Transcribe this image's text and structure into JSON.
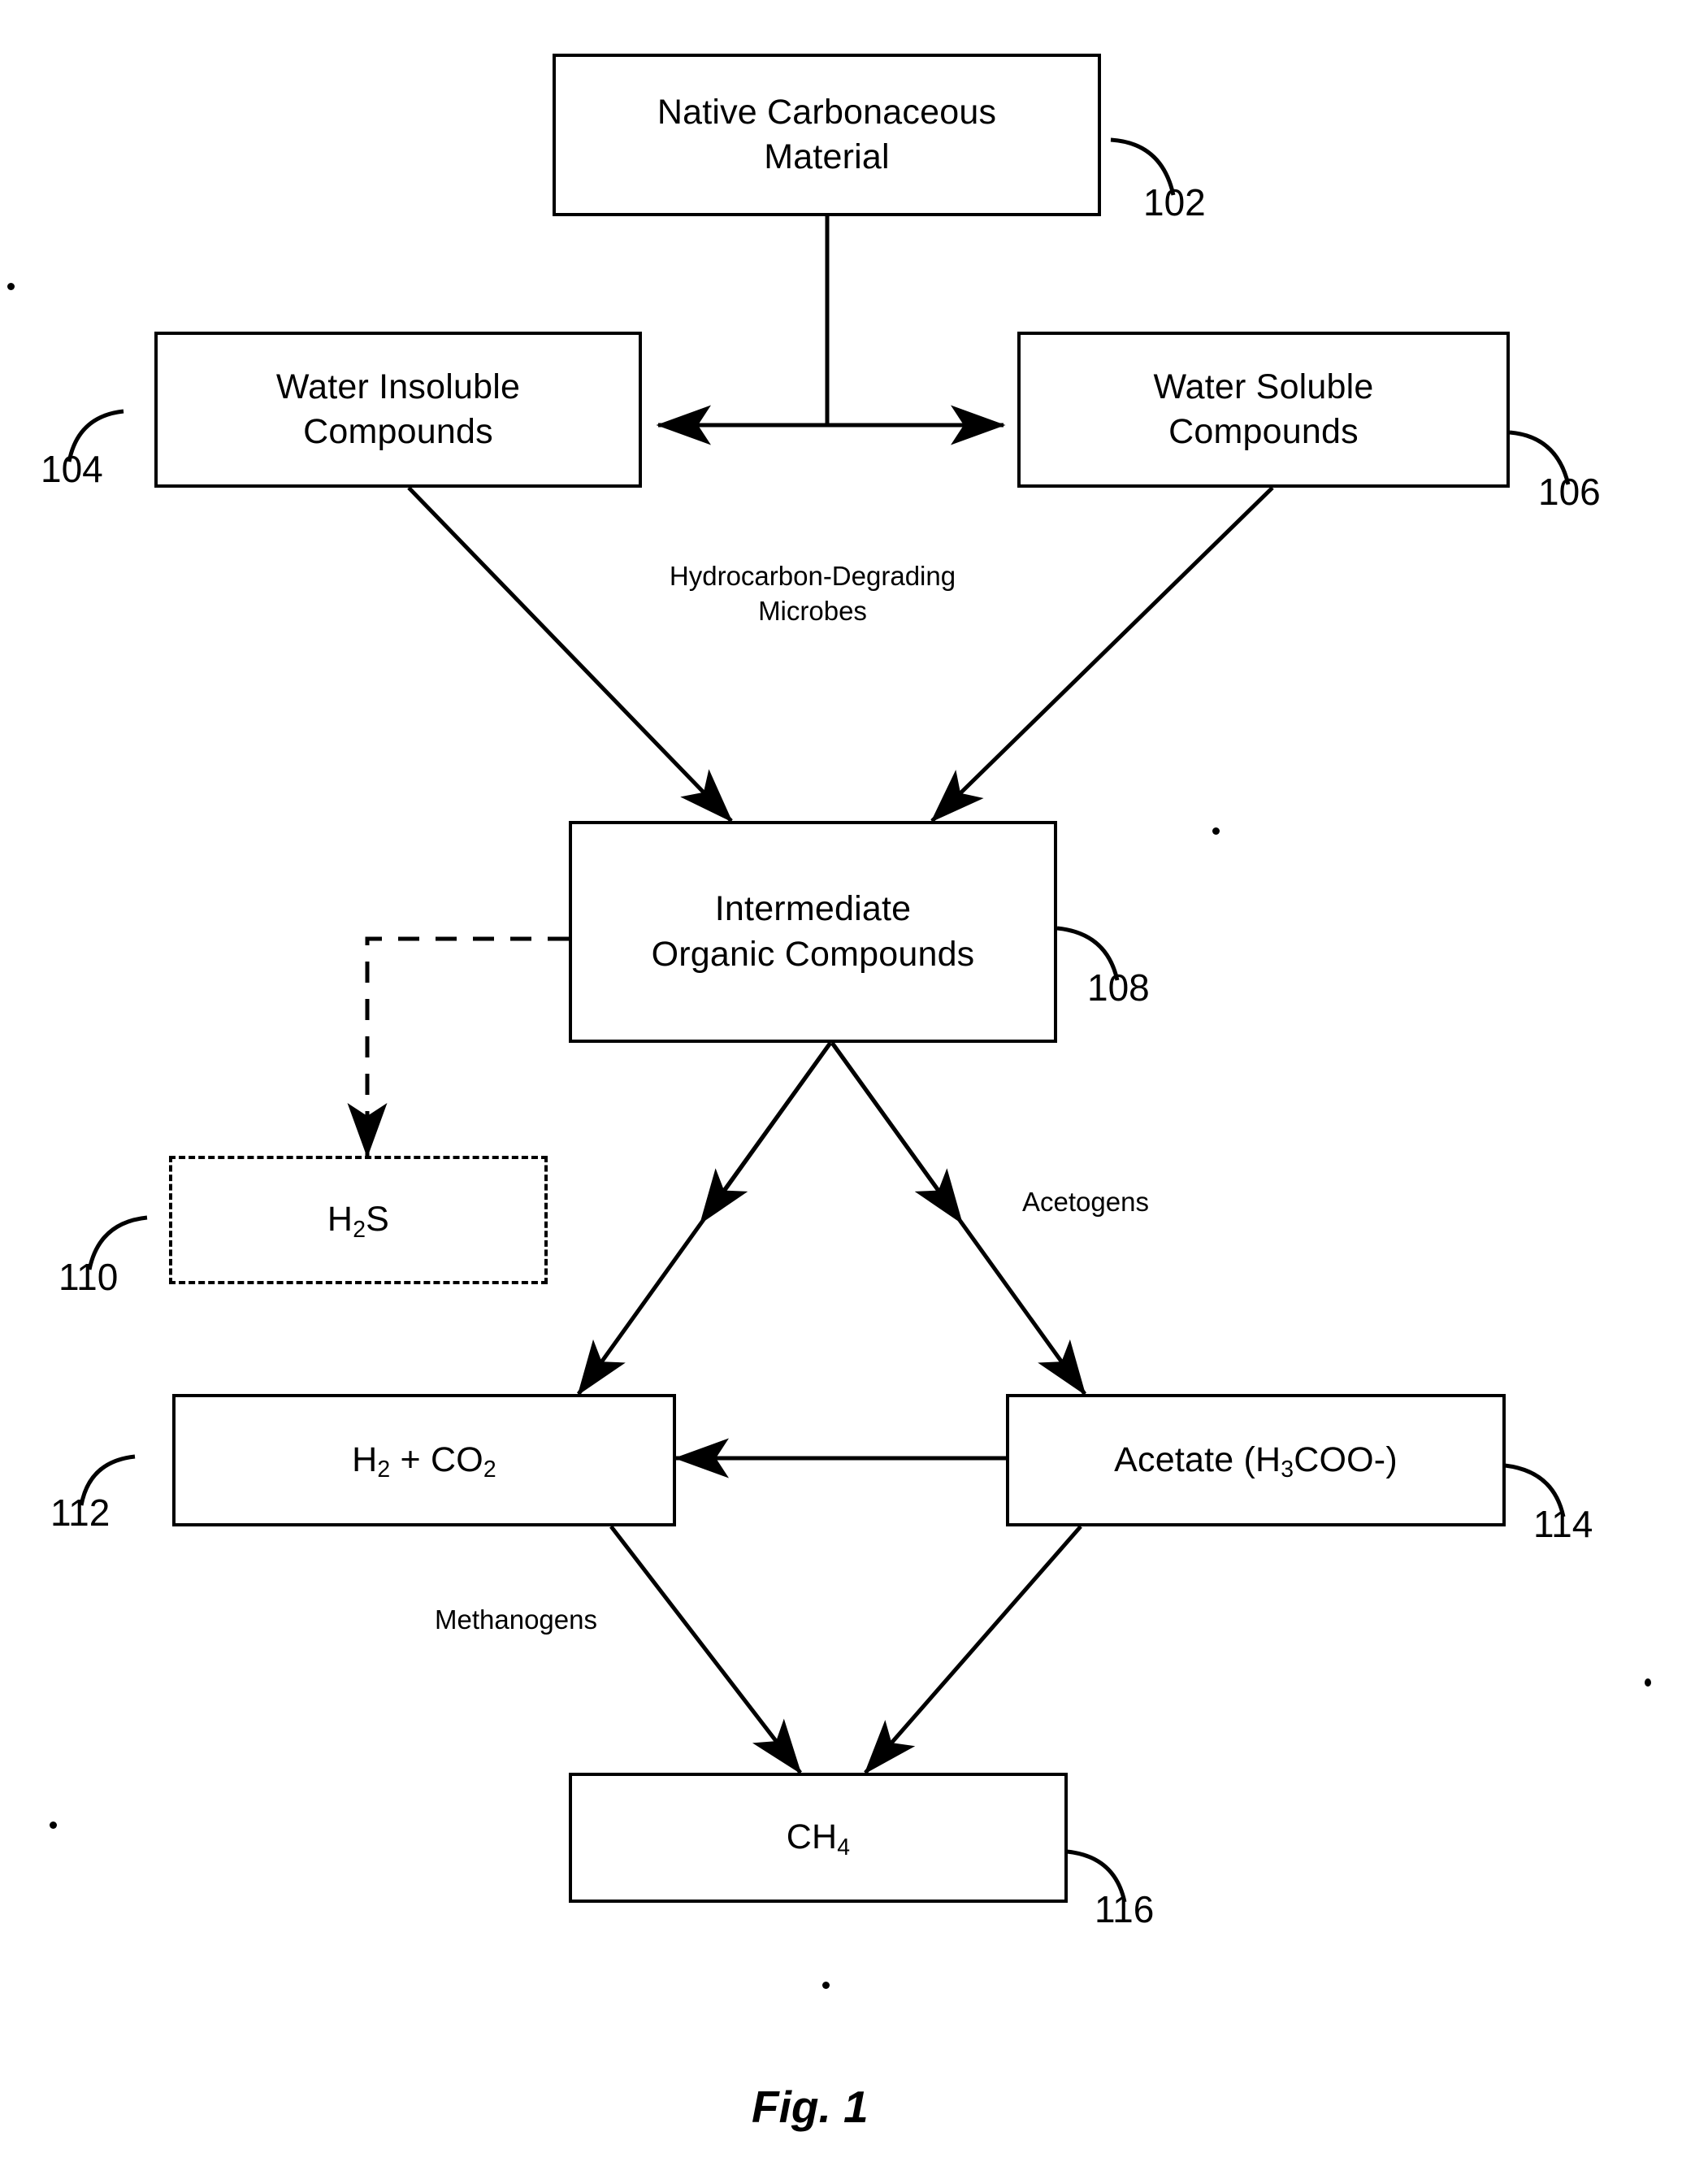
{
  "figure": {
    "caption": "Fig. 1",
    "type": "process-flow-diagram"
  },
  "nodes": [
    {
      "id": "102",
      "name": "native-carbonaceous-material",
      "label": "Native Carbonaceous\nMaterial",
      "ref": "102",
      "style": "solid"
    },
    {
      "id": "104",
      "name": "water-insoluble-compounds",
      "label": "Water Insoluble\nCompounds",
      "ref": "104",
      "style": "solid"
    },
    {
      "id": "106",
      "name": "water-soluble-compounds",
      "label": "Water Soluble\nCompounds",
      "ref": "106",
      "style": "solid"
    },
    {
      "id": "108",
      "name": "intermediate-organic-compounds",
      "label": "Intermediate\nOrganic Compounds",
      "ref": "108",
      "style": "solid"
    },
    {
      "id": "110",
      "name": "hydrogen-sulfide",
      "label": "H2S",
      "label_html": "H<sub>2</sub>S",
      "ref": "110",
      "style": "dashed"
    },
    {
      "id": "112",
      "name": "hydrogen-plus-carbon-dioxide",
      "label": "H2 + CO2",
      "label_html": "H<sub>2</sub> + CO<sub>2</sub>",
      "ref": "112",
      "style": "solid"
    },
    {
      "id": "114",
      "name": "acetate",
      "label": "Acetate (H3COO-)",
      "label_html": "Acetate (H<sub>3</sub>COO-)",
      "ref": "114",
      "style": "solid"
    },
    {
      "id": "116",
      "name": "methane",
      "label": "CH4",
      "label_html": "CH<sub>4</sub>",
      "ref": "116",
      "style": "solid"
    }
  ],
  "edge_labels": [
    {
      "id": "hydrocarbon-degrading-microbes",
      "text": "Hydrocarbon-Degrading\nMicrobes"
    },
    {
      "id": "acetogens",
      "text": "Acetogens"
    },
    {
      "id": "methanogens",
      "text": "Methanogens"
    }
  ],
  "edges": [
    {
      "from": "102",
      "to": "104",
      "arrow": "single",
      "style": "solid"
    },
    {
      "from": "102",
      "to": "106",
      "arrow": "single",
      "style": "solid"
    },
    {
      "from": "104",
      "to": "106",
      "arrow": "double",
      "style": "solid"
    },
    {
      "from": "104",
      "to": "108",
      "arrow": "single",
      "style": "solid"
    },
    {
      "from": "106",
      "to": "108",
      "arrow": "single",
      "style": "solid"
    },
    {
      "from": "108",
      "to": "110",
      "arrow": "single",
      "style": "dashed"
    },
    {
      "from": "108",
      "to": "112",
      "arrow": "single",
      "style": "solid"
    },
    {
      "from": "108",
      "to": "114",
      "arrow": "single",
      "style": "solid"
    },
    {
      "from": "114",
      "to": "112",
      "arrow": "single",
      "style": "solid"
    },
    {
      "from": "112",
      "to": "116",
      "arrow": "single",
      "style": "solid"
    },
    {
      "from": "114",
      "to": "116",
      "arrow": "single",
      "style": "solid"
    }
  ],
  "colors": {
    "ink": "#000000",
    "paper": "#ffffff"
  }
}
